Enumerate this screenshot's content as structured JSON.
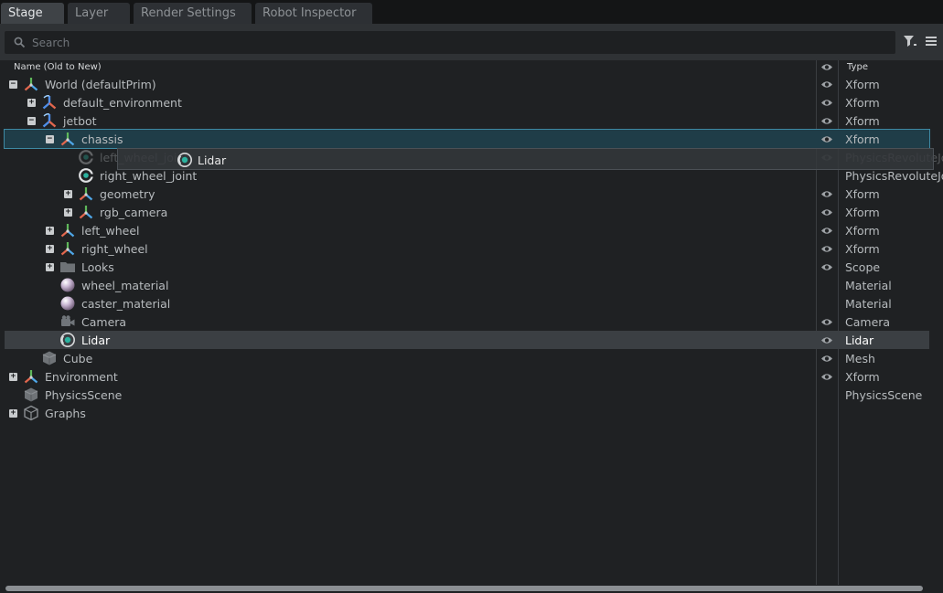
{
  "tabs": [
    {
      "label": "Stage",
      "active": true
    },
    {
      "label": "Layer",
      "active": false
    },
    {
      "label": "Render Settings",
      "active": false
    },
    {
      "label": "Robot Inspector",
      "active": false
    }
  ],
  "search": {
    "placeholder": "Search",
    "value": ""
  },
  "columns": {
    "name": "Name (Old to New)",
    "type": "Type"
  },
  "tree": [
    {
      "name": "World (defaultPrim)",
      "type": "Xform",
      "depth": 0,
      "toggle": "minus",
      "icon": "xform-icon",
      "eye": true
    },
    {
      "name": "default_environment",
      "type": "Xform",
      "depth": 1,
      "toggle": "plus",
      "icon": "xform-reference-icon",
      "eye": true
    },
    {
      "name": "jetbot",
      "type": "Xform",
      "depth": 1,
      "toggle": "minus",
      "icon": "xform-reference-icon",
      "eye": true
    },
    {
      "name": "chassis",
      "type": "Xform",
      "depth": 2,
      "toggle": "minus",
      "icon": "xform-icon",
      "eye": true,
      "state": "drop-target"
    },
    {
      "name": "left_wheel_joint",
      "type": "PhysicsRevoluteJoint",
      "depth": 3,
      "toggle": "",
      "icon": "joint-icon",
      "eye": true,
      "faded": true
    },
    {
      "name": "right_wheel_joint",
      "type": "PhysicsRevoluteJoint",
      "depth": 3,
      "toggle": "",
      "icon": "joint-icon",
      "eye": false
    },
    {
      "name": "geometry",
      "type": "Xform",
      "depth": 3,
      "toggle": "plus",
      "icon": "xform-icon",
      "eye": true
    },
    {
      "name": "rgb_camera",
      "type": "Xform",
      "depth": 3,
      "toggle": "plus",
      "icon": "xform-icon",
      "eye": true
    },
    {
      "name": "left_wheel",
      "type": "Xform",
      "depth": 2,
      "toggle": "plus",
      "icon": "xform-icon",
      "eye": true
    },
    {
      "name": "right_wheel",
      "type": "Xform",
      "depth": 2,
      "toggle": "plus",
      "icon": "xform-icon",
      "eye": true
    },
    {
      "name": "Looks",
      "type": "Scope",
      "depth": 2,
      "toggle": "plus",
      "icon": "folder-icon",
      "eye": true
    },
    {
      "name": "wheel_material",
      "type": "Material",
      "depth": 2,
      "toggle": "",
      "icon": "material-sphere-icon",
      "eye": false
    },
    {
      "name": "caster_material",
      "type": "Material",
      "depth": 2,
      "toggle": "",
      "icon": "material-sphere-icon",
      "eye": false
    },
    {
      "name": "Camera",
      "type": "Camera",
      "depth": 2,
      "toggle": "",
      "icon": "camera-icon",
      "eye": true
    },
    {
      "name": "Lidar",
      "type": "Lidar",
      "depth": 2,
      "toggle": "",
      "icon": "lidar-icon",
      "eye": true,
      "state": "selected"
    },
    {
      "name": "Cube",
      "type": "Mesh",
      "depth": 1,
      "toggle": "",
      "icon": "cube-icon",
      "eye": true
    },
    {
      "name": "Environment",
      "type": "Xform",
      "depth": 0,
      "toggle": "plus",
      "icon": "xform-icon",
      "eye": true
    },
    {
      "name": "PhysicsScene",
      "type": "PhysicsScene",
      "depth": 0,
      "toggle": "",
      "icon": "cube-icon",
      "eye": false
    },
    {
      "name": "Graphs",
      "type": "",
      "depth": 0,
      "toggle": "plus",
      "icon": "graph-cube-icon",
      "eye": false
    }
  ],
  "drag_ghost": {
    "label": "Lidar",
    "icon": "lidar-icon"
  },
  "colors": {
    "background": "#1f2123",
    "accent_teal": "#2bb3a0",
    "selection": "#3b3f43",
    "drop_target": "#1f3d48"
  }
}
